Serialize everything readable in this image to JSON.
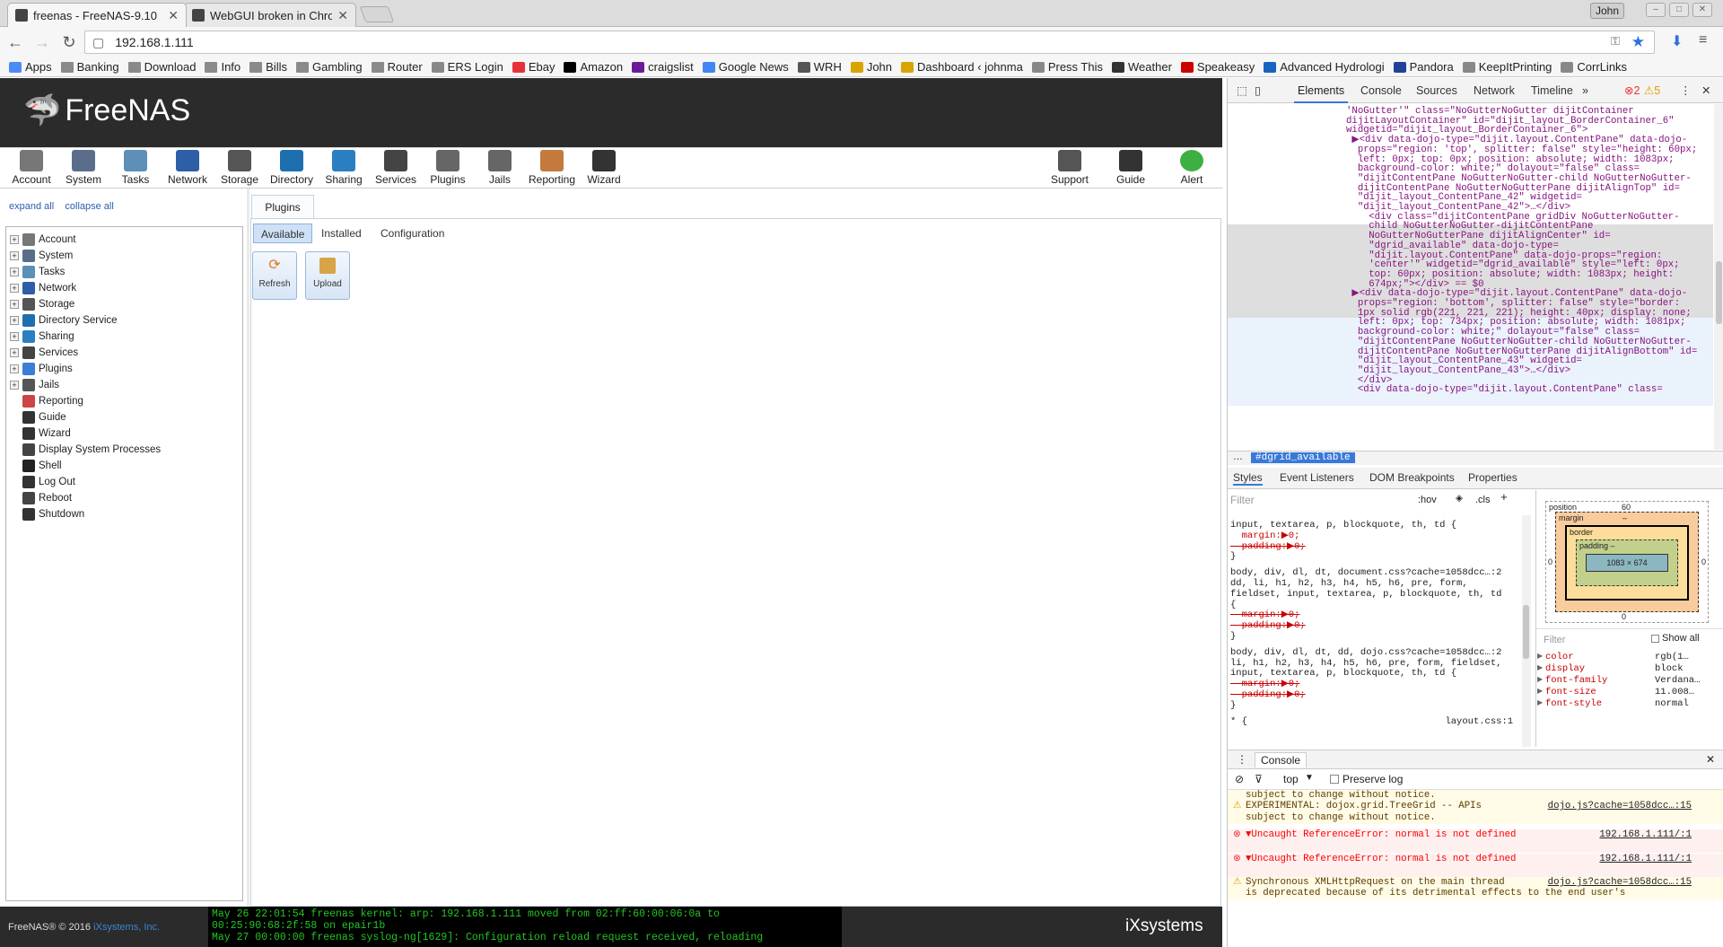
{
  "browser": {
    "tabs": [
      {
        "title": "freenas - FreeNAS-9.10"
      },
      {
        "title": "WebGUI broken in Chro"
      }
    ],
    "profile": "John",
    "url": "192.168.1.111",
    "bookmarks": [
      "Apps",
      "Banking",
      "Download",
      "Info",
      "Bills",
      "Gambling",
      "Router",
      "ERS Login",
      "Ebay",
      "Amazon",
      "craigslist",
      "Google News",
      "WRH",
      "John",
      "Dashboard ‹ johnma",
      "Press This",
      "Weather",
      "Speakeasy",
      "Advanced Hydrologi",
      "Pandora",
      "KeepItPrinting",
      "CorrLinks"
    ]
  },
  "freenas": {
    "logo": "FreeNAS",
    "topmenu": [
      "Account",
      "System",
      "Tasks",
      "Network",
      "Storage",
      "Directory",
      "Sharing",
      "Services",
      "Plugins",
      "Jails",
      "Reporting",
      "Wizard"
    ],
    "topmenu_right": [
      "Support",
      "Guide",
      "Alert"
    ],
    "expand_all": "expand all",
    "collapse_all": "collapse all",
    "tree": [
      {
        "label": "Account",
        "expandable": true
      },
      {
        "label": "System",
        "expandable": true
      },
      {
        "label": "Tasks",
        "expandable": true
      },
      {
        "label": "Network",
        "expandable": true
      },
      {
        "label": "Storage",
        "expandable": true
      },
      {
        "label": "Directory Service",
        "expandable": true
      },
      {
        "label": "Sharing",
        "expandable": true
      },
      {
        "label": "Services",
        "expandable": true
      },
      {
        "label": "Plugins",
        "expandable": true
      },
      {
        "label": "Jails",
        "expandable": true
      },
      {
        "label": "Reporting",
        "expandable": false
      },
      {
        "label": "Guide",
        "expandable": false
      },
      {
        "label": "Wizard",
        "expandable": false
      },
      {
        "label": "Display System Processes",
        "expandable": false
      },
      {
        "label": "Shell",
        "expandable": false
      },
      {
        "label": "Log Out",
        "expandable": false
      },
      {
        "label": "Reboot",
        "expandable": false
      },
      {
        "label": "Shutdown",
        "expandable": false
      }
    ],
    "main_tab": "Plugins",
    "subtabs": [
      "Available",
      "Installed",
      "Configuration"
    ],
    "buttons": [
      "Refresh",
      "Upload"
    ],
    "copyright": "FreeNAS® © 2016 ",
    "copyright_link": "iXsystems, Inc.",
    "log_lines": [
      "May 26 22:01:54 freenas kernel: arp: 192.168.1.111 moved from 02:ff:60:00:06:0a to",
      "00:25:90:68:2f:58 on epair1b",
      "May 27 00:00:00 freenas syslog-ng[1629]: Configuration reload request received, reloading"
    ],
    "vendor_logo": "iXsystems"
  },
  "devtools": {
    "tabs": [
      "Elements",
      "Console",
      "Sources",
      "Network",
      "Timeline"
    ],
    "errors": "2",
    "warnings": "5",
    "code_lines": [
      "'NoGutter'\" class=\"NoGutterNoGutter dijitContainer",
      "dijitLayoutContainer\" id=\"dijit_layout_BorderContainer_6\"",
      "widgetid=\"dijit_layout_BorderContainer_6\">",
      " ▶<div data-dojo-type=\"dijit.layout.ContentPane\" data-dojo-",
      "  props=\"region: 'top', splitter: false\" style=\"height: 60px;",
      "  left: 0px; top: 0px; position: absolute; width: 1083px;",
      "  background-color: white;\" dolayout=\"false\" class=",
      "  \"dijitContentPane NoGutterNoGutter-child NoGutterNoGutter-",
      "  dijitContentPane NoGutterNoGutterPane dijitAlignTop\" id=",
      "  \"dijit_layout_ContentPane_42\" widgetid=",
      "  \"dijit_layout_ContentPane_42\">…</div>",
      "   <div class=\"dijitContentPane gridDiv NoGutterNoGutter-",
      "   child NoGutterNoGutter-dijitContentPane",
      "   NoGutterNoGutterPane dijitAlignCenter\" id=",
      "   \"dgrid_available\" data-dojo-type=",
      "   \"dijit.layout.ContentPane\" data-dojo-props=\"region:",
      "   'center'\" widgetid=\"dgrid_available\" style=\"left: 0px;",
      "   top: 60px; position: absolute; width: 1083px; height:",
      "   674px;\"></div> == $0",
      " ▶<div data-dojo-type=\"dijit.layout.ContentPane\" data-dojo-",
      "  props=\"region: 'bottom', splitter: false\" style=\"border:",
      "  1px solid rgb(221, 221, 221); height: 40px; display: none;",
      "  left: 0px; top: 734px; position: absolute; width: 1081px;",
      "  background-color: white;\" dolayout=\"false\" class=",
      "  \"dijitContentPane NoGutterNoGutter-child NoGutterNoGutter-",
      "  dijitContentPane NoGutterNoGutterPane dijitAlignBottom\" id=",
      "  \"dijit_layout_ContentPane_43\" widgetid=",
      "  \"dijit_layout_ContentPane_43\">…</div>",
      "  </div>",
      "  <div data-dojo-type=\"dijit.layout.ContentPane\" class="
    ],
    "breadcrumb": "#dgrid_available",
    "styles_tabs": [
      "Styles",
      "Event Listeners",
      "DOM Breakpoints",
      "Properties"
    ],
    "filter_placeholder": "Filter",
    "hov": ":hov",
    "cls": ".cls",
    "style_lines": [
      "input, textarea, p, blockquote, th, td {",
      "  margin:▶0;",
      "  padding:▶0;",
      "}",
      "body, div, dl, dt, document.css?cache=1058dcc…:2",
      "dd, li, h1, h2, h3, h4, h5, h6, pre, form,",
      "fieldset, input, textarea, p, blockquote, th, td",
      "{",
      "  margin:▶0;",
      "  padding:▶0;",
      "}",
      "body, div, dl, dt, dd, dojo.css?cache=1058dcc…:2",
      "li, h1, h2, h3, h4, h5, h6, pre, form, fieldset,",
      "input, textarea, p, blockquote, th, td {",
      "  margin:▶0;",
      "  padding:▶0;",
      "}",
      "* {                                   layout.css:1"
    ],
    "boxmodel": {
      "position_label": "position",
      "position": "60",
      "margin": "margin",
      "border": "border",
      "padding": "padding –",
      "content": "1083 × 674",
      "left": "0",
      "right": "0",
      "bottom": "0",
      "dash": "–"
    },
    "computed": [
      {
        "prop": "color",
        "val": "rgb(1…"
      },
      {
        "prop": "display",
        "val": "block"
      },
      {
        "prop": "font-family",
        "val": "Verdana…"
      },
      {
        "prop": "font-size",
        "val": "11.008…"
      },
      {
        "prop": "font-style",
        "val": "normal"
      }
    ],
    "show_all": "Show all",
    "console_title": "Console",
    "console_context": "top",
    "preserve_log": "Preserve log",
    "messages": [
      {
        "kind": "warn",
        "text": "subject to change without notice.",
        "src": ""
      },
      {
        "kind": "warn",
        "text": "EXPERIMENTAL: dojox.grid.TreeGrid -- APIs",
        "src": "dojo.js?cache=1058dcc…:15"
      },
      {
        "kind": "warn",
        "text": "subject to change without notice.",
        "src": ""
      },
      {
        "kind": "err",
        "text": "▼Uncaught ReferenceError: normal is not defined",
        "src": "192.168.1.111/:1"
      },
      {
        "kind": "err",
        "text": "▼Uncaught ReferenceError: normal is not defined",
        "src": "192.168.1.111/:1"
      },
      {
        "kind": "warn",
        "text": "Synchronous XMLHttpRequest on the main thread",
        "src": "dojo.js?cache=1058dcc…:15"
      },
      {
        "kind": "warn",
        "text": "is deprecated because of its detrimental effects to the end user's",
        "src": ""
      }
    ]
  }
}
